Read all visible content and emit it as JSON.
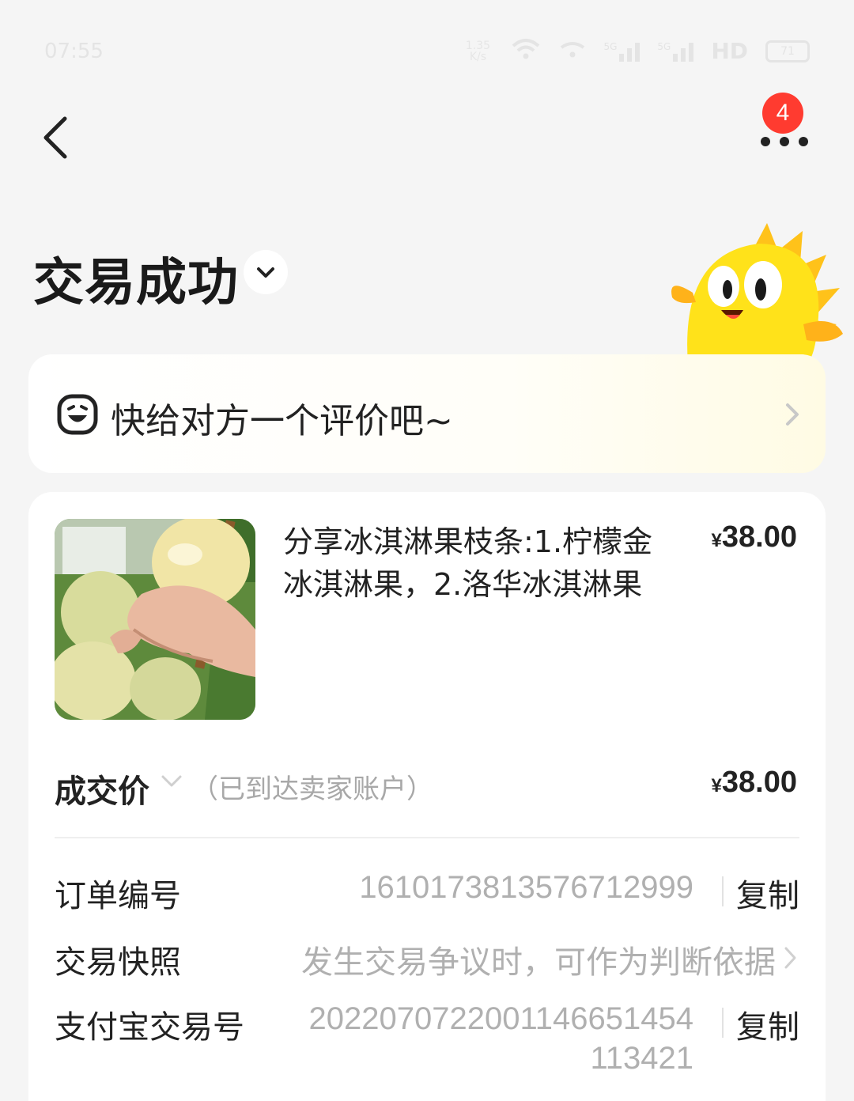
{
  "status_bar": {
    "time": "07:55",
    "network_speed_value": "1.35",
    "network_speed_unit": "K/s",
    "signal_label_1": "5G",
    "signal_label_2": "5G",
    "hd_label": "HD",
    "battery_level": "71"
  },
  "header": {
    "notification_count": "4",
    "status_title": "交易成功"
  },
  "review_prompt": {
    "text": "快给对方一个评价吧~"
  },
  "order": {
    "product_title": "分享冰淇淋果枝条:1.柠檬金冰淇淋果，2.洛华冰淇淋果",
    "currency": "¥",
    "product_price": "38.00",
    "final_price_label": "成交价",
    "final_price_note": "（已到达卖家账户）",
    "final_price": "38.00"
  },
  "details": {
    "order_number_label": "订单编号",
    "order_number": "1610173813576712999",
    "copy_label": "复制",
    "snapshot_label": "交易快照",
    "snapshot_note": "发生交易争议时，可作为判断依据",
    "alipay_label": "支付宝交易号",
    "alipay_number_line1": "2022070722001146651454",
    "alipay_number_line2": "113421"
  },
  "icons": {
    "back": "chevron-left-icon",
    "more": "more-dots-icon",
    "title_toggle": "chevron-down-icon",
    "review": "smiley-face-icon",
    "review_arrow": "chevron-right-icon",
    "price_toggle": "chevron-down-icon",
    "snapshot_arrow": "chevron-right-icon"
  },
  "colors": {
    "badge": "#ff3b30",
    "mascot": "#ffd400",
    "muted_text": "#b0b0b0"
  }
}
